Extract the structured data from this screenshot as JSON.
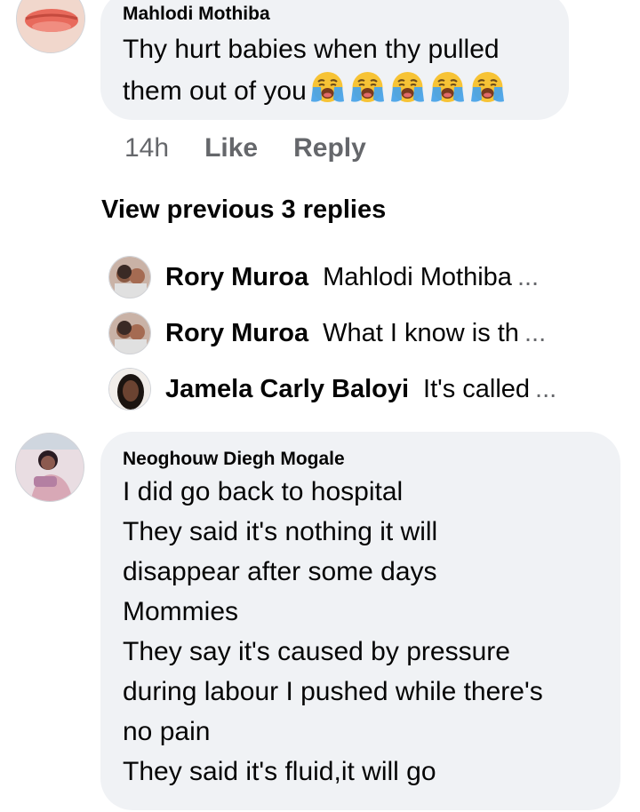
{
  "comment1": {
    "author": "Mahlodi Mothiba",
    "lines": [
      "Thy hurt babies when thy pulled",
      "them out of you"
    ],
    "emoji_icon": "loudly-crying-face-icon",
    "emoji_count": 5
  },
  "comment1_meta": {
    "time": "14h",
    "like_label": "Like",
    "reply_label": "Reply"
  },
  "view_previous_label": "View previous 3 replies",
  "replies": [
    {
      "name": "Rory Muroa",
      "snippet": "Mahlodi Mothiba",
      "ellipsis": "..."
    },
    {
      "name": "Rory Muroa",
      "snippet": "What I know is th",
      "ellipsis": "..."
    },
    {
      "name": "Jamela Carly Baloyi",
      "snippet": "It's called",
      "ellipsis": "..."
    }
  ],
  "comment2": {
    "author": "Neoghouw Diegh Mogale",
    "lines": [
      "I did go back to hospital",
      "They said it's nothing it will",
      "disappear after some days",
      "Mommies",
      "They say it's caused by pressure",
      "during labour I pushed while there's",
      "no pain",
      "They said it's fluid,it will go"
    ]
  },
  "colors": {
    "bubble_bg": "#f0f2f5",
    "meta_text": "#65676b",
    "text": "#050505"
  }
}
